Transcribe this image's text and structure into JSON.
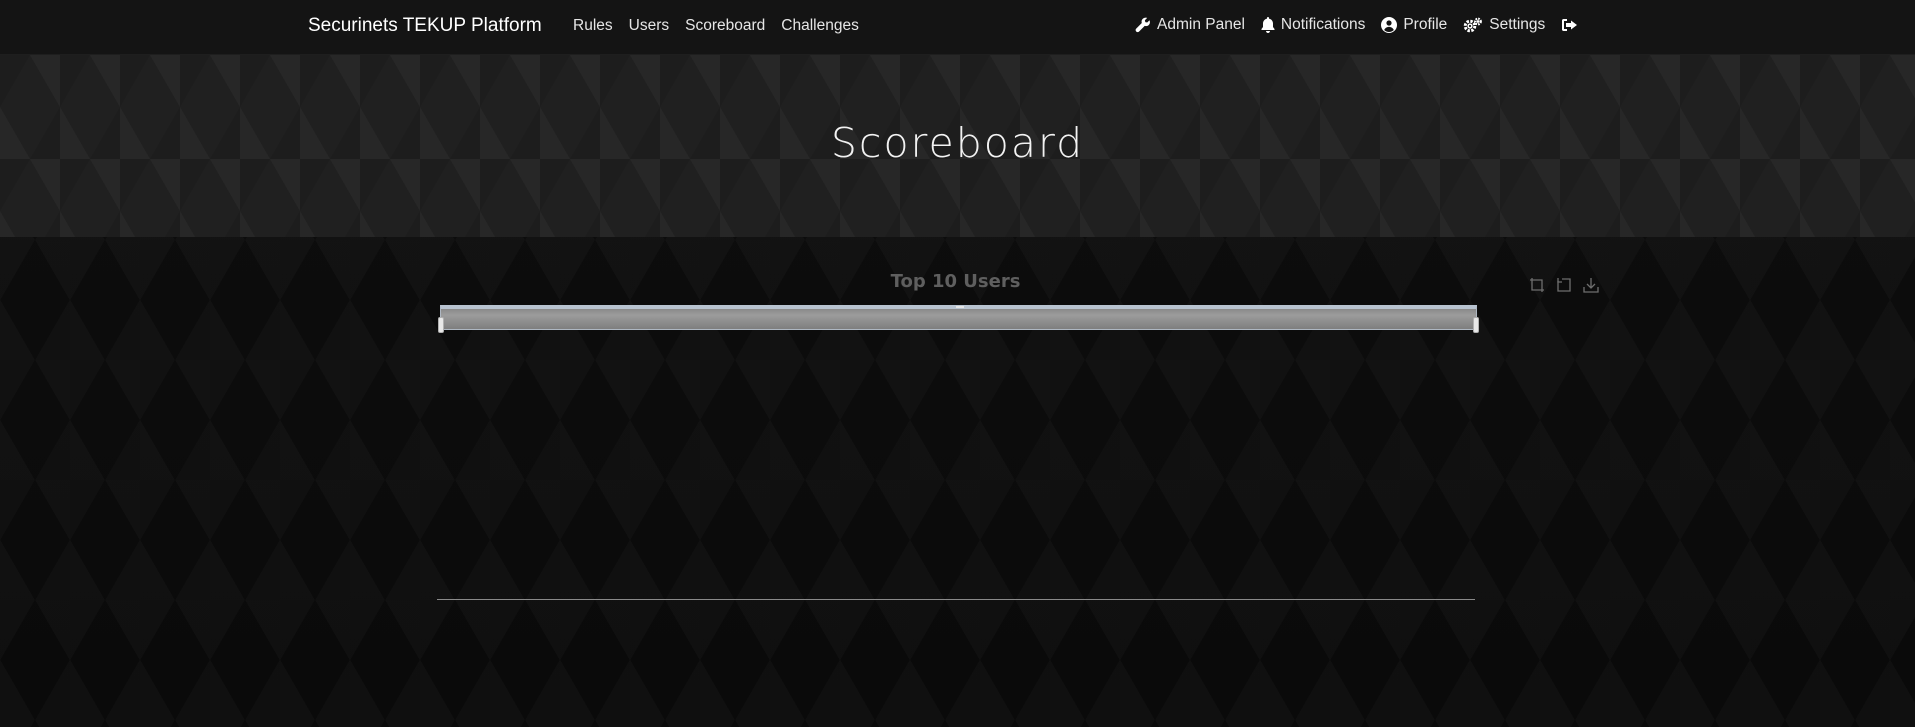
{
  "navbar": {
    "brand": "Securinets TEKUP Platform",
    "links": [
      "Rules",
      "Users",
      "Scoreboard",
      "Challenges"
    ],
    "right": {
      "admin_panel": "Admin Panel",
      "notifications": "Notifications",
      "profile": "Profile",
      "settings": "Settings"
    },
    "icons": [
      "wrench-icon",
      "bell-icon",
      "user-circle-icon",
      "cogs-icon",
      "logout-icon"
    ]
  },
  "jumbotron": {
    "title": "Scoreboard"
  },
  "chart_data": {
    "type": "line",
    "title": "Top 10 Users",
    "series": [],
    "toolbox": [
      "zoom-icon",
      "zoom-reset-icon",
      "save-image-icon"
    ],
    "datazoom": {
      "start": 0,
      "end": 100
    }
  },
  "colors": {
    "navbar_bg": "#141414",
    "jumbotron_bg": "#202020",
    "page_bg": "#0b0b0b",
    "chart_title": "#5f5f5f"
  }
}
